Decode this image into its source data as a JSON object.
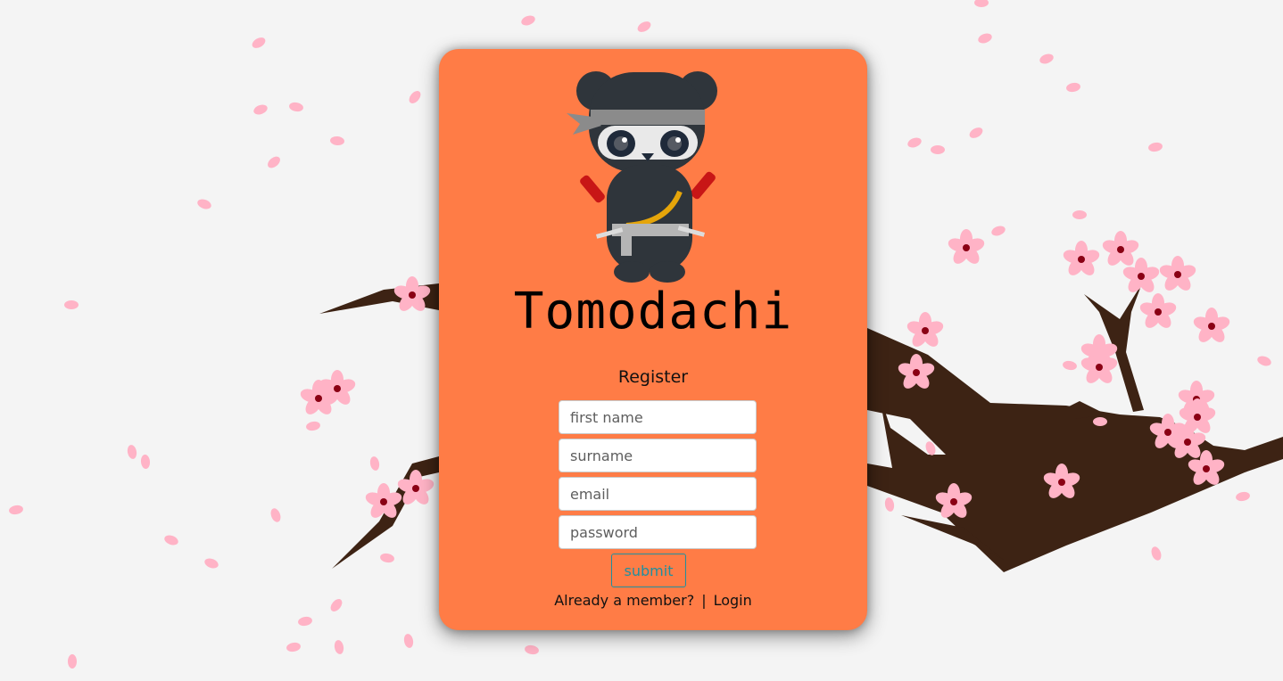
{
  "app": {
    "title": "Tomodachi"
  },
  "form": {
    "heading": "Register",
    "fields": {
      "first_name": {
        "placeholder": "first name",
        "value": ""
      },
      "surname": {
        "placeholder": "surname",
        "value": ""
      },
      "email": {
        "placeholder": "email",
        "value": ""
      },
      "password": {
        "placeholder": "password",
        "value": ""
      }
    },
    "submit_label": "submit"
  },
  "footer": {
    "prompt": "Already a member?",
    "separator": "|",
    "login_label": "Login"
  },
  "colors": {
    "background": "#f4f4f4",
    "card": "#ff7c46",
    "accent": "#1f8f9f",
    "petal": "#ffb3c6",
    "branch": "#3d2314"
  },
  "icons": {
    "mascot": "ninja-panda-icon"
  }
}
